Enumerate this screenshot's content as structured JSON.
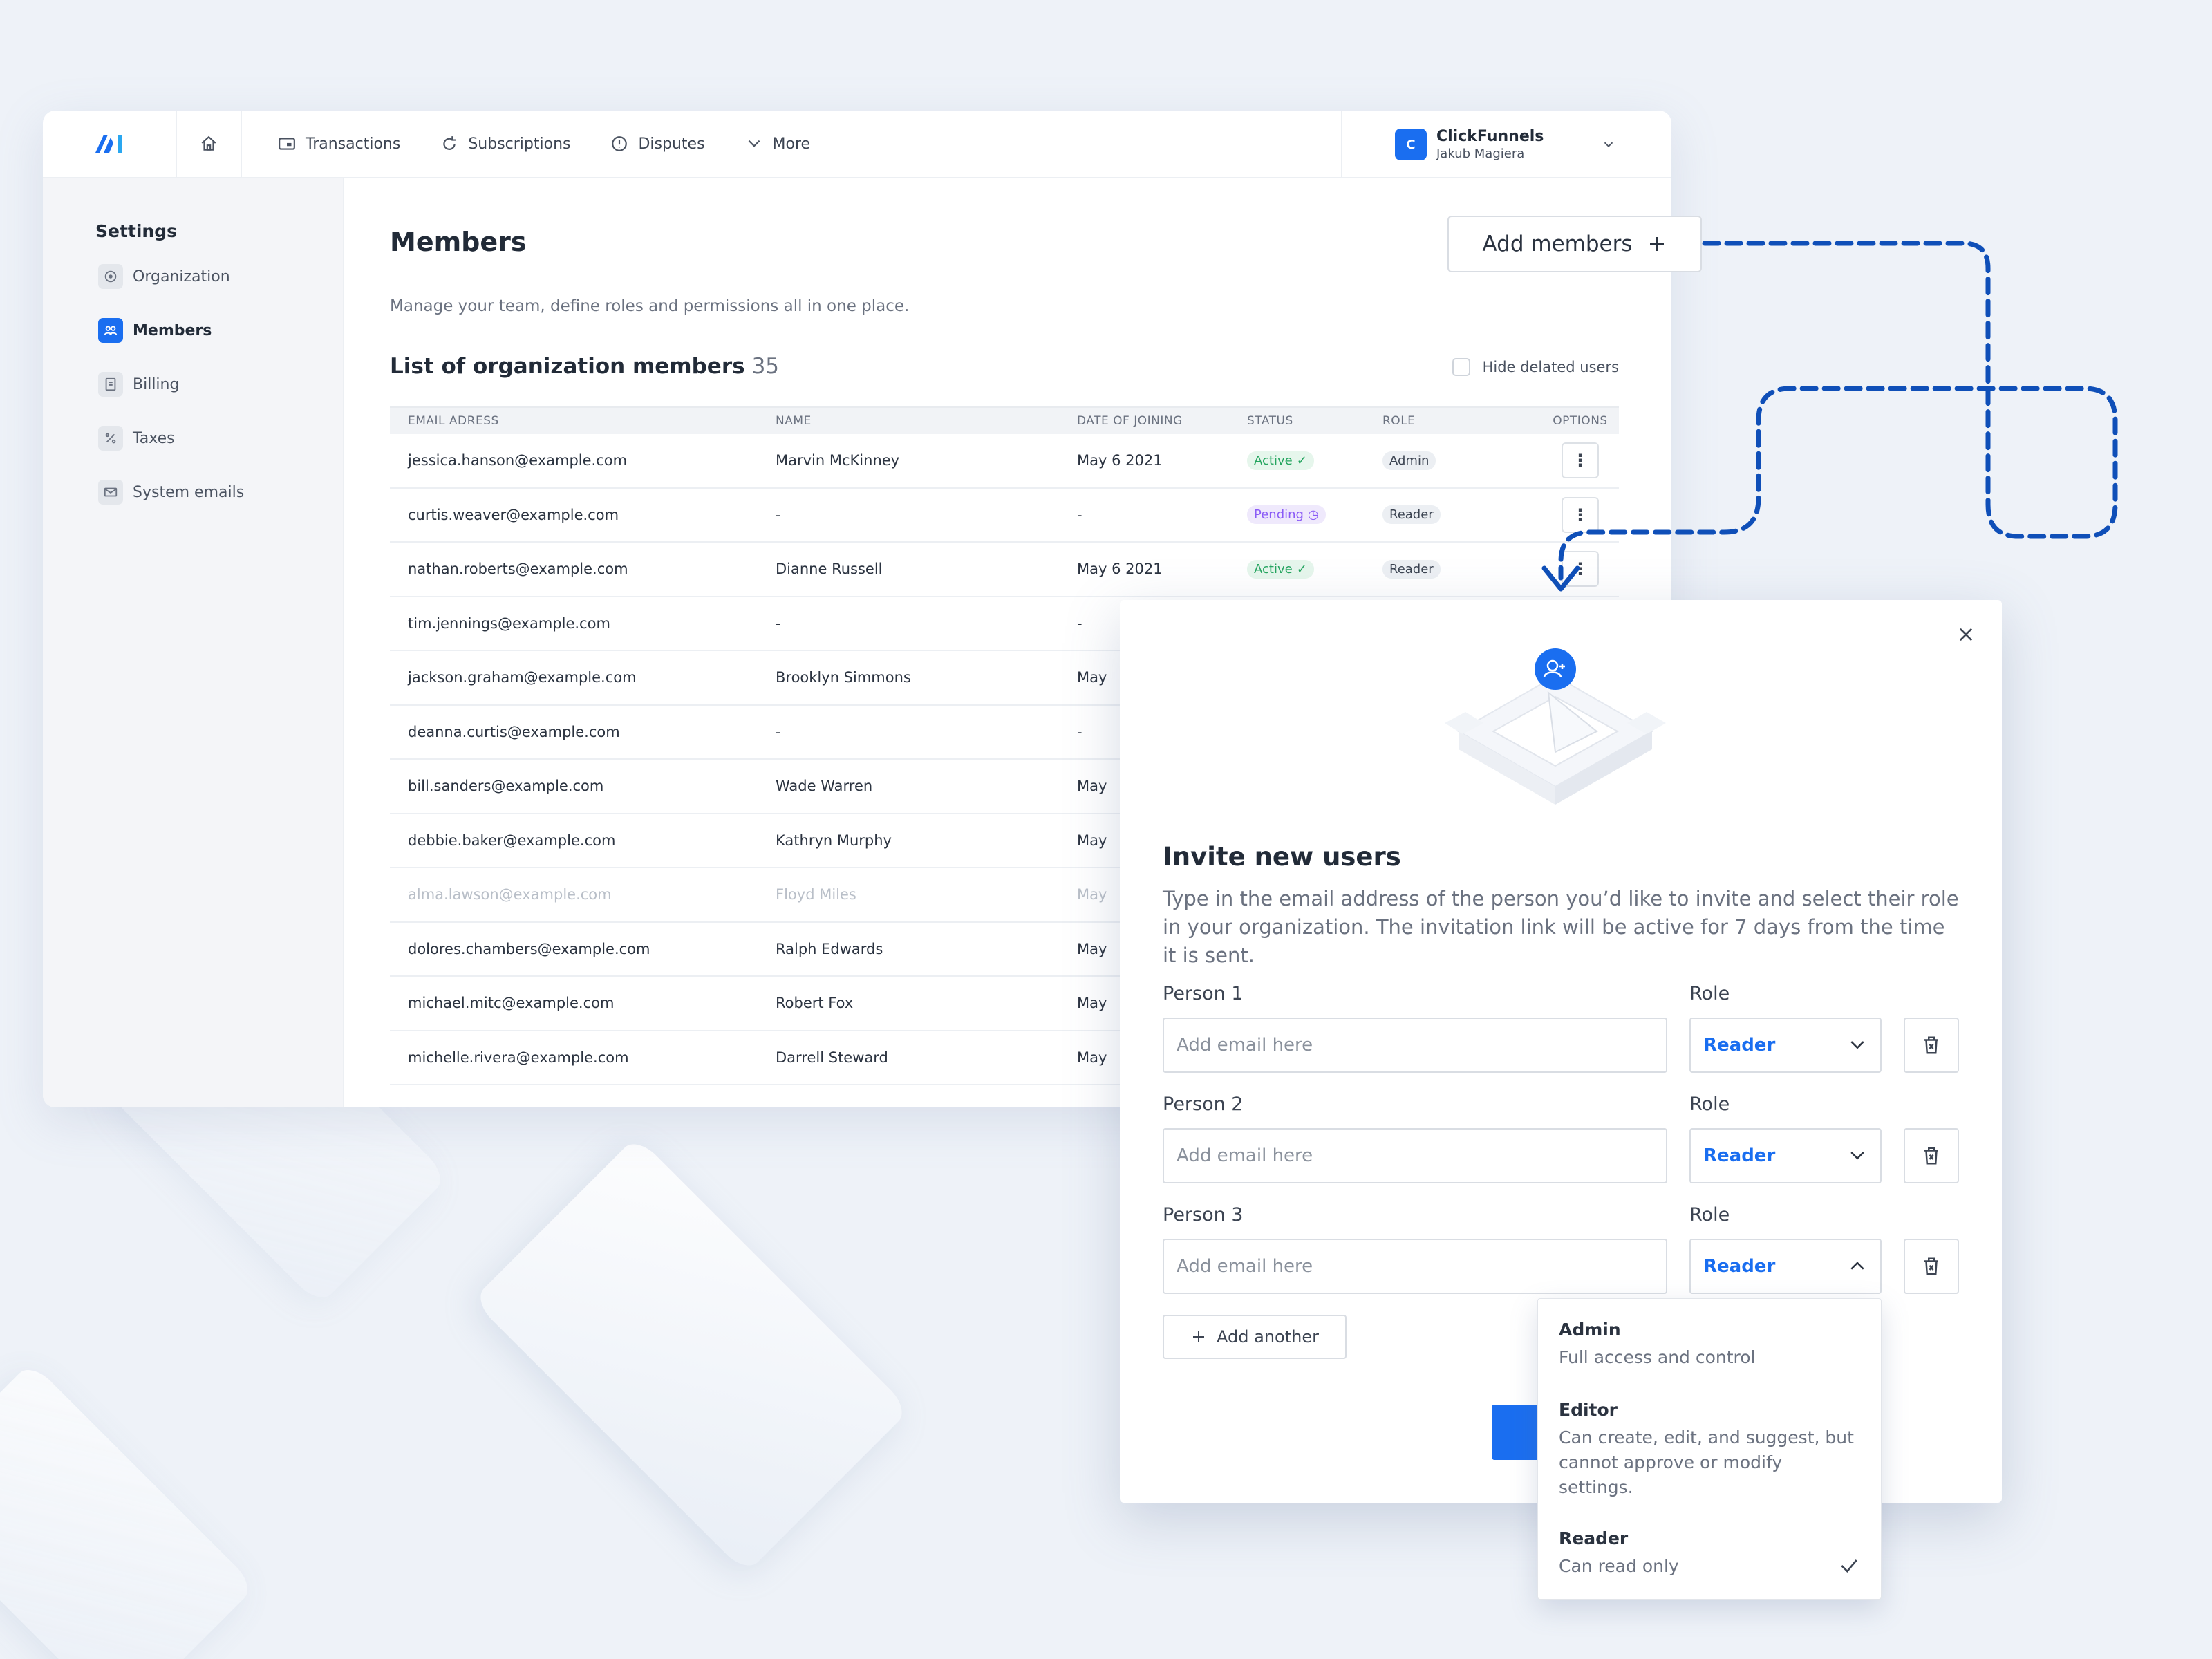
{
  "topbar": {
    "nav": [
      {
        "label": "Transactions",
        "icon": "card-icon"
      },
      {
        "label": "Subscriptions",
        "icon": "refresh-icon"
      },
      {
        "label": "Disputes",
        "icon": "alert-circle-icon"
      },
      {
        "label": "More",
        "icon": "chevron-down-icon"
      }
    ],
    "org": {
      "initial": "C",
      "name": "ClickFunnels",
      "user": "Jakub Magiera"
    }
  },
  "sidebar": {
    "title": "Settings",
    "items": [
      {
        "label": "Organization",
        "icon": "organization-icon"
      },
      {
        "label": "Members",
        "icon": "members-icon",
        "active": true
      },
      {
        "label": "Billing",
        "icon": "billing-icon"
      },
      {
        "label": "Taxes",
        "icon": "percent-icon"
      },
      {
        "label": "System emails",
        "icon": "mail-icon"
      }
    ]
  },
  "members": {
    "title": "Members",
    "subtitle": "Manage your team, define roles and permissions all in one place.",
    "add_button": "Add members",
    "list_title": "List of organization members",
    "count": "35",
    "hide_deleted": "Hide delated users",
    "columns": [
      "EMAIL ADRESS",
      "NAME",
      "DATE OF JOINING",
      "STATUS",
      "ROLE",
      "OPTIONS"
    ],
    "rows": [
      {
        "email": "jessica.hanson@example.com",
        "name": "Marvin McKinney",
        "date": "May 6  2021",
        "status": "Active",
        "role": "Admin"
      },
      {
        "email": "curtis.weaver@example.com",
        "name": "-",
        "date": "-",
        "status": "Pending",
        "role": "Reader"
      },
      {
        "email": "nathan.roberts@example.com",
        "name": "Dianne Russell",
        "date": "May 6  2021",
        "status": "Active",
        "role": "Reader"
      },
      {
        "email": "tim.jennings@example.com",
        "name": "-",
        "date": "-",
        "status": "",
        "role": ""
      },
      {
        "email": "jackson.graham@example.com",
        "name": "Brooklyn Simmons",
        "date": "May",
        "status": "",
        "role": ""
      },
      {
        "email": "deanna.curtis@example.com",
        "name": "-",
        "date": "-",
        "status": "",
        "role": ""
      },
      {
        "email": "bill.sanders@example.com",
        "name": "Wade Warren",
        "date": "May",
        "status": "",
        "role": ""
      },
      {
        "email": "debbie.baker@example.com",
        "name": "Kathryn Murphy",
        "date": "May",
        "status": "",
        "role": ""
      },
      {
        "email": "alma.lawson@example.com",
        "name": "Floyd Miles",
        "date": "May",
        "status": "",
        "role": "",
        "muted": true
      },
      {
        "email": "dolores.chambers@example.com",
        "name": "Ralph Edwards",
        "date": "May",
        "status": "",
        "role": ""
      },
      {
        "email": "michael.mitc@example.com",
        "name": "Robert Fox",
        "date": "May",
        "status": "",
        "role": ""
      },
      {
        "email": "michelle.rivera@example.com",
        "name": "Darrell Steward",
        "date": "May",
        "status": "",
        "role": ""
      }
    ]
  },
  "modal": {
    "title": "Invite new users",
    "description": "Type in the email address of the person you’d like to invite and select their role in your organization. The invitation link will be active for 7 days from the time it is sent.",
    "role_label": "Role",
    "email_placeholder": "Add email here",
    "persons": [
      {
        "label": "Person 1",
        "role": "Reader"
      },
      {
        "label": "Person 2",
        "role": "Reader"
      },
      {
        "label": "Person 3",
        "role": "Reader"
      }
    ],
    "add_another": "Add another",
    "role_options": [
      {
        "title": "Admin",
        "desc": "Full access and control"
      },
      {
        "title": "Editor",
        "desc": "Can create, edit, and suggest, but cannot approve or modify settings."
      },
      {
        "title": "Reader",
        "desc": "Can read only",
        "selected": true
      }
    ]
  },
  "colors": {
    "accent": "#1a6ef0",
    "active": "#25a55f",
    "pending": "#8b5cf6",
    "connector": "#0f4fb8"
  }
}
